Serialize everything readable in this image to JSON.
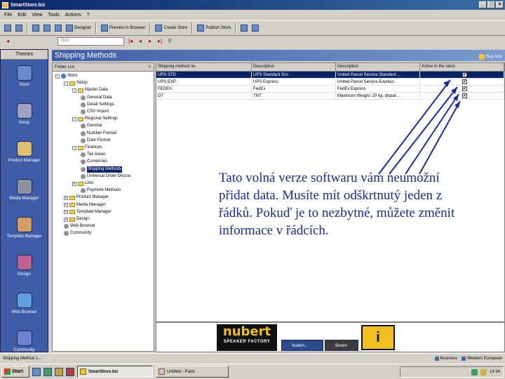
{
  "window": {
    "title": "SmartStore.biz",
    "buttons": [
      "_",
      "□",
      "×"
    ]
  },
  "menu": [
    "File",
    "Edit",
    "View",
    "Tools",
    "Actions",
    "?"
  ],
  "toolbar": {
    "buttons": [
      "Designer",
      "Preview in Browser",
      "Create Store",
      "Publish Store"
    ]
  },
  "address": {
    "value": "Stdo"
  },
  "sidebar": {
    "header": "Themes",
    "items": [
      {
        "label": "Store",
        "color": "#6a8ad0"
      },
      {
        "label": "Setup",
        "color": "#a0a0c0"
      },
      {
        "label": "Product Manager",
        "color": "#e0c070"
      },
      {
        "label": "Media Manager",
        "color": "#9090a0"
      },
      {
        "label": "Template Manager",
        "color": "#d0a060"
      },
      {
        "label": "Design",
        "color": "#c06090"
      },
      {
        "label": "Web Browser",
        "color": "#60a0e0"
      },
      {
        "label": "Community",
        "color": "#7080d0"
      }
    ]
  },
  "main": {
    "title": "Shipping Methods",
    "buy_now": "Buy now"
  },
  "folders": {
    "header": "Folder List",
    "close": "×",
    "tree": [
      {
        "label": "Store",
        "indent": 0,
        "exp": "−",
        "icon": "globe"
      },
      {
        "label": "Setup",
        "indent": 1,
        "exp": "−",
        "icon": "folder"
      },
      {
        "label": "Master Data",
        "indent": 2,
        "exp": "−",
        "icon": "folder"
      },
      {
        "label": "General Data",
        "indent": 3,
        "exp": "",
        "icon": "gear"
      },
      {
        "label": "Detail Settings",
        "indent": 3,
        "exp": "",
        "icon": "gear"
      },
      {
        "label": "CSV Import",
        "indent": 3,
        "exp": "",
        "icon": "gear"
      },
      {
        "label": "Regional Settings",
        "indent": 2,
        "exp": "−",
        "icon": "folder"
      },
      {
        "label": "General",
        "indent": 3,
        "exp": "",
        "icon": "gear"
      },
      {
        "label": "Number Format",
        "indent": 3,
        "exp": "",
        "icon": "gear"
      },
      {
        "label": "Date Format",
        "indent": 3,
        "exp": "",
        "icon": "gear"
      },
      {
        "label": "Finances",
        "indent": 2,
        "exp": "−",
        "icon": "folder"
      },
      {
        "label": "Tax Areas",
        "indent": 3,
        "exp": "",
        "icon": "gear"
      },
      {
        "label": "Currencies",
        "indent": 3,
        "exp": "",
        "icon": "gear"
      },
      {
        "label": "Shipping Methods",
        "indent": 3,
        "exp": "",
        "icon": "gear",
        "selected": true
      },
      {
        "label": "Universal Order Discou",
        "indent": 3,
        "exp": "",
        "icon": "gear"
      },
      {
        "label": "Lists",
        "indent": 2,
        "exp": "+",
        "icon": "folder"
      },
      {
        "label": "Payment Methods",
        "indent": 3,
        "exp": "",
        "icon": "gear"
      },
      {
        "label": "Product Manager",
        "indent": 1,
        "exp": "+",
        "icon": "folder"
      },
      {
        "label": "Media Manager",
        "indent": 1,
        "exp": "+",
        "icon": "folder"
      },
      {
        "label": "Template Manager",
        "indent": 1,
        "exp": "+",
        "icon": "folder"
      },
      {
        "label": "Design",
        "indent": 1,
        "exp": "+",
        "icon": "folder"
      },
      {
        "label": "Web Browser",
        "indent": 1,
        "exp": "",
        "icon": "gear"
      },
      {
        "label": "Community",
        "indent": 1,
        "exp": "",
        "icon": "gear"
      }
    ]
  },
  "grid": {
    "columns": [
      "Shipping method no.",
      "Description",
      "Description",
      "Active in the store"
    ],
    "rows": [
      {
        "cells": [
          "UPS STD",
          "UPS Standard 3nn",
          "United Parcel Service Standard ...",
          "✔"
        ],
        "selected": true
      },
      {
        "cells": [
          "UPS EXP",
          "UPS Express",
          "United Parcel Service Express",
          "✔"
        ],
        "selected": false
      },
      {
        "cells": [
          "FEDEX",
          "FedEx",
          "FedEx Express",
          "✔"
        ],
        "selected": false
      },
      {
        "cells": [
          "DT",
          "TNT",
          "Maximum Weight: 20 kg, dispat...",
          "✔"
        ],
        "selected": false
      }
    ]
  },
  "banner": {
    "brand": "nubert",
    "tagline": "SPEAKER FACTORY",
    "tab1": "Nubert...",
    "tab2": "Boxen",
    "logo_glyph": "i"
  },
  "overlay": {
    "text": "Tato volná verze softwaru vám neumožní přidat data. Musíte mít odškrtnutý jeden z řádků. Pokuď je to nezbytné, můžete změnit informace v řádcích."
  },
  "status": {
    "left": "Shipping Method 1...",
    "tray1": "Business",
    "tray2": "Western European"
  },
  "taskbar": {
    "start": "Start",
    "items": [
      "SmartStore.biz",
      "Untitled - Paint"
    ],
    "clock": "14:34"
  }
}
